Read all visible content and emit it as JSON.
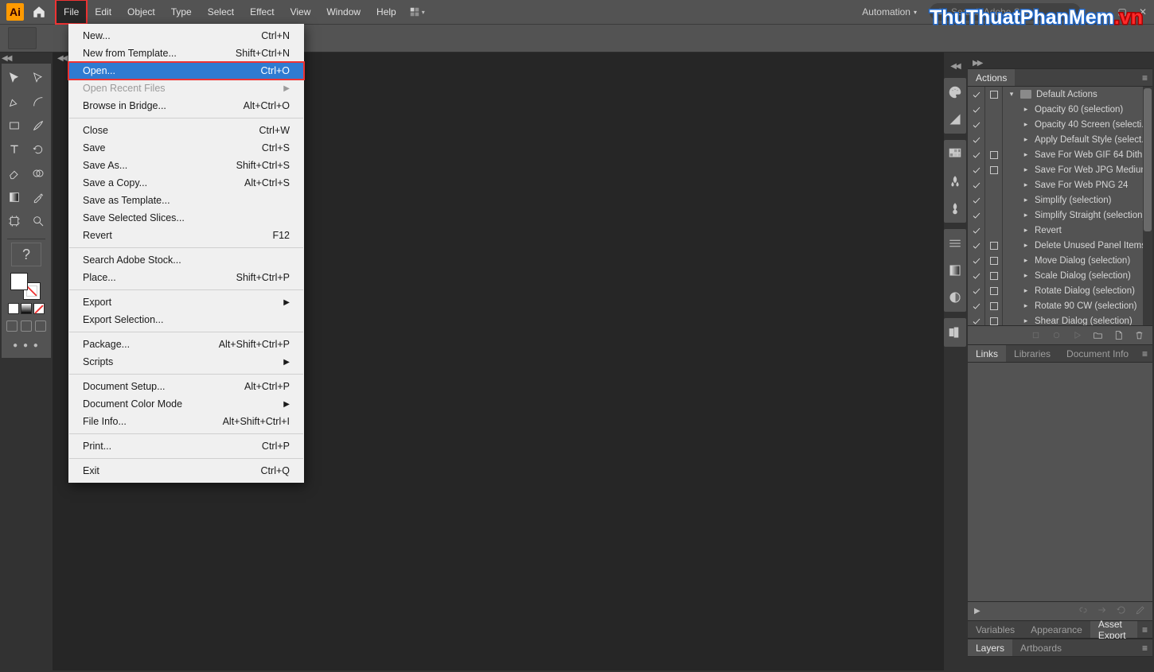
{
  "topbar": {
    "app": "Ai",
    "menus": [
      "File",
      "Edit",
      "Object",
      "Type",
      "Select",
      "Effect",
      "View",
      "Window",
      "Help"
    ],
    "automation": "Automation",
    "search_placeholder": "Search Adobe Stock"
  },
  "file_menu": {
    "highlighted_menu": "File",
    "highlighted_item": "Open...",
    "groups": [
      [
        {
          "label": "New...",
          "shortcut": "Ctrl+N"
        },
        {
          "label": "New from Template...",
          "shortcut": "Shift+Ctrl+N"
        },
        {
          "label": "Open...",
          "shortcut": "Ctrl+O",
          "hover": true
        },
        {
          "label": "Open Recent Files",
          "submenu": true,
          "disabled": true
        },
        {
          "label": "Browse in Bridge...",
          "shortcut": "Alt+Ctrl+O"
        }
      ],
      [
        {
          "label": "Close",
          "shortcut": "Ctrl+W"
        },
        {
          "label": "Save",
          "shortcut": "Ctrl+S"
        },
        {
          "label": "Save As...",
          "shortcut": "Shift+Ctrl+S"
        },
        {
          "label": "Save a Copy...",
          "shortcut": "Alt+Ctrl+S"
        },
        {
          "label": "Save as Template..."
        },
        {
          "label": "Save Selected Slices..."
        },
        {
          "label": "Revert",
          "shortcut": "F12"
        }
      ],
      [
        {
          "label": "Search Adobe Stock..."
        },
        {
          "label": "Place...",
          "shortcut": "Shift+Ctrl+P"
        }
      ],
      [
        {
          "label": "Export",
          "submenu": true
        },
        {
          "label": "Export Selection..."
        }
      ],
      [
        {
          "label": "Package...",
          "shortcut": "Alt+Shift+Ctrl+P"
        },
        {
          "label": "Scripts",
          "submenu": true
        }
      ],
      [
        {
          "label": "Document Setup...",
          "shortcut": "Alt+Ctrl+P"
        },
        {
          "label": "Document Color Mode",
          "submenu": true
        },
        {
          "label": "File Info...",
          "shortcut": "Alt+Shift+Ctrl+I"
        }
      ],
      [
        {
          "label": "Print...",
          "shortcut": "Ctrl+P"
        }
      ],
      [
        {
          "label": "Exit",
          "shortcut": "Ctrl+Q"
        }
      ]
    ]
  },
  "actions_panel": {
    "tab": "Actions",
    "folder": "Default Actions",
    "items": [
      {
        "check": true,
        "box": false,
        "label": "Opacity 60 (selection)"
      },
      {
        "check": true,
        "box": false,
        "label": "Opacity 40 Screen (selecti..."
      },
      {
        "check": true,
        "box": false,
        "label": "Apply Default Style (select..."
      },
      {
        "check": true,
        "box": true,
        "label": "Save For Web GIF 64 Dith..."
      },
      {
        "check": true,
        "box": true,
        "label": "Save For Web JPG Medium"
      },
      {
        "check": true,
        "box": false,
        "label": "Save For Web PNG 24"
      },
      {
        "check": true,
        "box": false,
        "label": "Simplify (selection)"
      },
      {
        "check": true,
        "box": false,
        "label": "Simplify Straight (selection)"
      },
      {
        "check": true,
        "box": false,
        "label": "Revert"
      },
      {
        "check": true,
        "box": true,
        "label": "Delete Unused Panel Items"
      },
      {
        "check": true,
        "box": true,
        "label": "Move Dialog (selection)"
      },
      {
        "check": true,
        "box": true,
        "label": "Scale Dialog (selection)"
      },
      {
        "check": true,
        "box": true,
        "label": "Rotate Dialog (selection)"
      },
      {
        "check": true,
        "box": true,
        "label": "Rotate 90 CW (selection)"
      },
      {
        "check": true,
        "box": true,
        "label": "Shear Dialog (selection)"
      }
    ]
  },
  "links_panel": {
    "tabs": [
      "Links",
      "Libraries",
      "Document Info"
    ],
    "active": 0
  },
  "variables_panel": {
    "tabs": [
      "Variables",
      "Appearance",
      "Asset Export"
    ],
    "active": 2
  },
  "layers_panel": {
    "tabs": [
      "Layers",
      "Artboards"
    ],
    "active": 0
  },
  "watermark": {
    "a": "ThuThuatPhanMem",
    "b": ".vn"
  }
}
